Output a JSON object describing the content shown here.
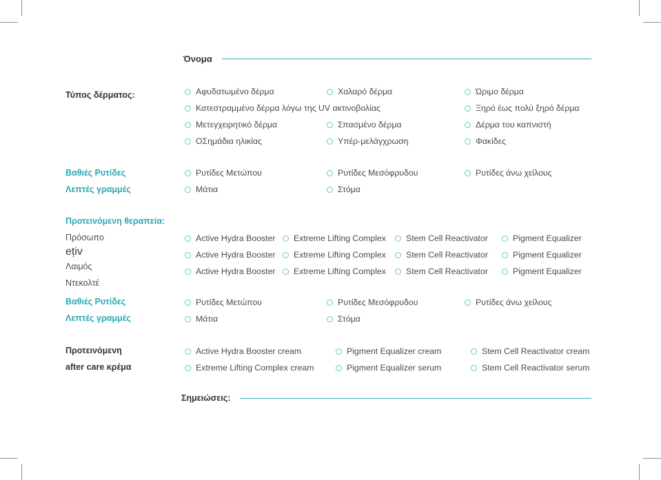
{
  "page": {
    "name_label": "Όνομα",
    "notes_label": "Σημειώσεις:",
    "accent": "#39aebb",
    "ring_color": "#63c4d2",
    "teal_heading": "#2aa9b5",
    "text_color": "#4a4a4a"
  },
  "skin_type": {
    "label": "Τύπος δέρματος:",
    "columns": [
      [
        "Αφυδατωμένο δέρμα",
        "Κατεστραμμένο δέρμα λόγω της UV ακτινοβολίας",
        "Μετεγχειρητικό δέρμα",
        "ΟΣημάδια ηλικίας"
      ],
      [
        "Χαλαρό δέρμα",
        "Σπασμένο δέρμα",
        "Υπέρ-μελάγχρωση"
      ],
      [
        "Ώριμο δέρμα",
        "Ξηρό έως πολύ ξηρό δέρμα",
        "Δέρμα του καπνιστή",
        "Φακίδες"
      ]
    ]
  },
  "wrinkles_1": {
    "labels": [
      "Βαθιές Ρυτίδες",
      "Λεπτές γραμμές"
    ],
    "row1": [
      "Ρυτίδες Μετώπου",
      "Ρυτίδες Μεσόφρυδου",
      "Ρυτίδες άνω χείλους"
    ],
    "row2": [
      "Μάτια",
      "Στόμα"
    ]
  },
  "treatment": {
    "heading": "Προτεινόμενη θεραπεία:",
    "rows": [
      {
        "label": "Πρόσωπο",
        "options": [
          "Active Hydra Booster",
          "Extreme Lifting Complex",
          "Stem Cell Reactivator",
          "Pigment Equalizer"
        ]
      },
      {
        "label": "Λαιμός",
        "options": [
          "Active Hydra Booster",
          "Extreme Lifting Complex",
          "Stem Cell Reactivator",
          "Pigment Equalizer"
        ]
      },
      {
        "label": "Ντεκολτέ",
        "options": [
          "Active Hydra Booster",
          "Extreme Lifting Complex",
          "Stem Cell Reactivator",
          "Pigment Equalizer"
        ]
      }
    ]
  },
  "wrinkles_2": {
    "labels": [
      "Βαθιές Ρυτίδες",
      "Λεπτές γραμμές"
    ],
    "row1": [
      "Ρυτίδες Μετώπου",
      "Ρυτίδες Μεσόφρυδου",
      "Ρυτίδες άνω χείλους"
    ],
    "row2": [
      "Μάτια",
      "Στόμα"
    ]
  },
  "aftercare": {
    "labels": [
      "Προτεινόμενη",
      "after care κρέμα"
    ],
    "row1": [
      "Active Hydra Booster cream",
      "Pigment Equalizer cream",
      "Stem Cell Reactivator cream"
    ],
    "row2": [
      "Extreme Lifting Complex cream",
      "Pigment Equalizer serum",
      "Stem Cell Reactivator serum"
    ]
  }
}
